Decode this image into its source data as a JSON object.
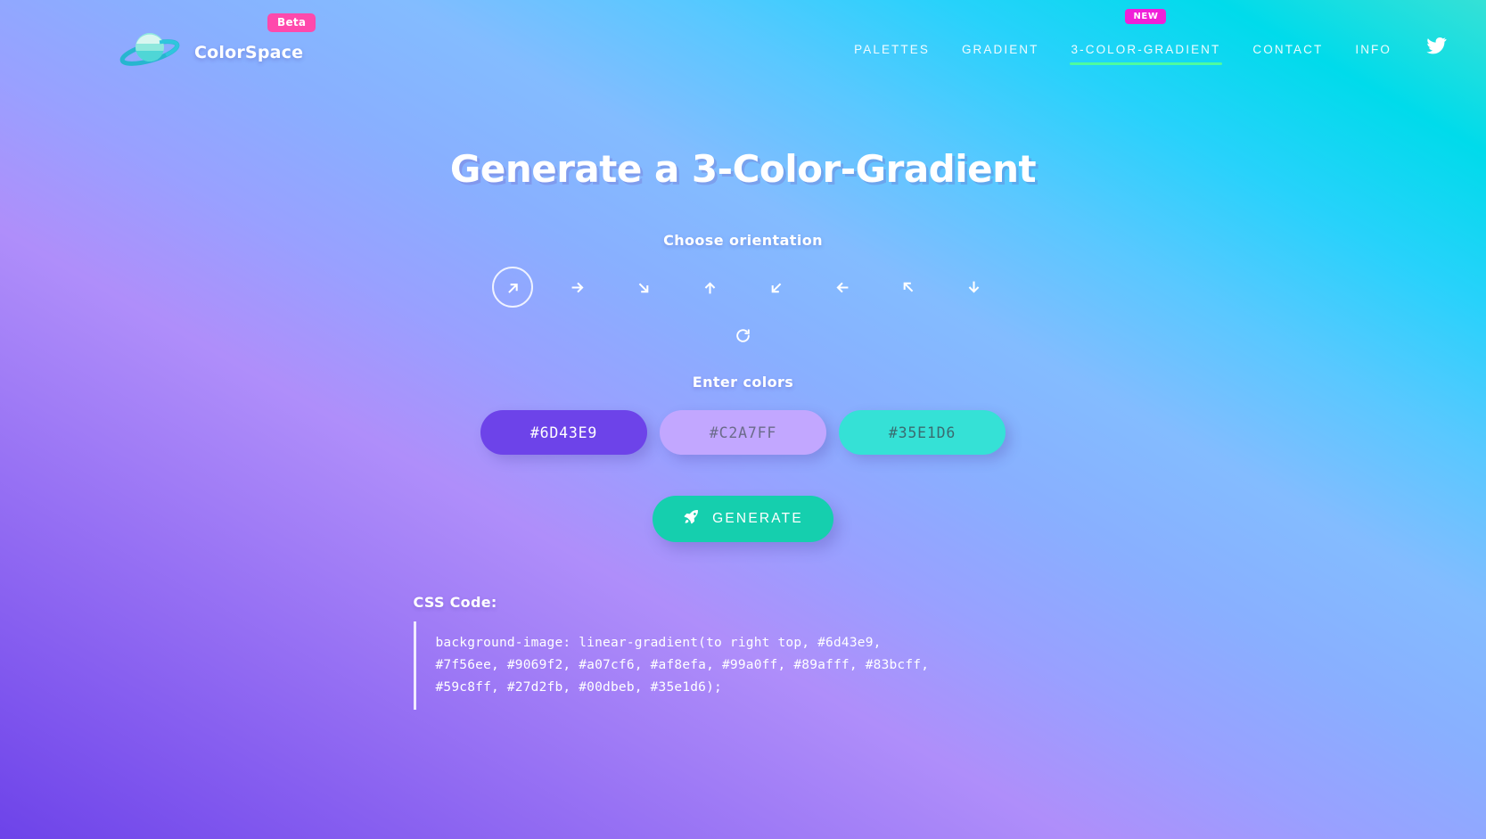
{
  "brand": {
    "name": "ColorSpace",
    "badge": "Beta",
    "logo_icon": "planet-icon"
  },
  "nav": {
    "items": [
      {
        "label": "PALETTES",
        "active": false,
        "badge": null
      },
      {
        "label": "GRADIENT",
        "active": false,
        "badge": null
      },
      {
        "label": "3-COLOR-GRADIENT",
        "active": true,
        "badge": "NEW"
      },
      {
        "label": "CONTACT",
        "active": false,
        "badge": null
      },
      {
        "label": "INFO",
        "active": false,
        "badge": null
      }
    ],
    "social_icon": "twitter-icon"
  },
  "main": {
    "title": "Generate a 3-Color-Gradient",
    "orientation_label": "Choose orientation",
    "orientation_options": [
      {
        "name": "arrow-up-right-icon",
        "glyph": "↗",
        "selected": true
      },
      {
        "name": "arrow-right-icon",
        "glyph": "→",
        "selected": false
      },
      {
        "name": "arrow-down-right-icon",
        "glyph": "↘",
        "selected": false
      },
      {
        "name": "arrow-down-icon",
        "glyph": "↓",
        "selected": false
      },
      {
        "name": "arrow-down-left-icon",
        "glyph": "↙",
        "selected": false
      },
      {
        "name": "arrow-left-icon",
        "glyph": "←",
        "selected": false
      },
      {
        "name": "arrow-up-left-icon",
        "glyph": "↖",
        "selected": false
      },
      {
        "name": "arrow-up-icon",
        "glyph": "↑",
        "selected": false
      }
    ],
    "refresh_icon": "refresh-icon",
    "colors_label": "Enter colors",
    "color_inputs": [
      {
        "value": "#6D43E9",
        "bg": "#6D43E9",
        "text_color": "#ffffff"
      },
      {
        "value": "#C2A7FF",
        "bg": "#C2A7FF",
        "text_color": "#6b6b8a"
      },
      {
        "value": "#35E1D6",
        "bg": "#35E1D6",
        "text_color": "#3a6b70"
      }
    ],
    "generate_button": {
      "label": "GENERATE",
      "icon": "rocket-icon",
      "color": "#15CFAE"
    }
  },
  "css_output": {
    "title": "CSS Code:",
    "code": "background-image: linear-gradient(to right top, #6d43e9, #7f56ee, #9069f2, #a07cf6, #af8efa, #99a0ff, #89afff, #83bcff, #59c8ff, #27d2fb, #00dbeb, #35e1d6);"
  },
  "theme": {
    "background_gradient": "linear-gradient(to right top, #6d43e9, #7f56ee, #9069f2, #a07cf6, #af8efa, #99a0ff, #89afff, #83bcff, #59c8ff, #27d2fb, #00dbeb, #35e1d6)",
    "accent_green": "#4DFBA0",
    "badge_pink": "#FF49AC",
    "badge_magenta": "#F020D8",
    "button_teal": "#15CFAE"
  }
}
